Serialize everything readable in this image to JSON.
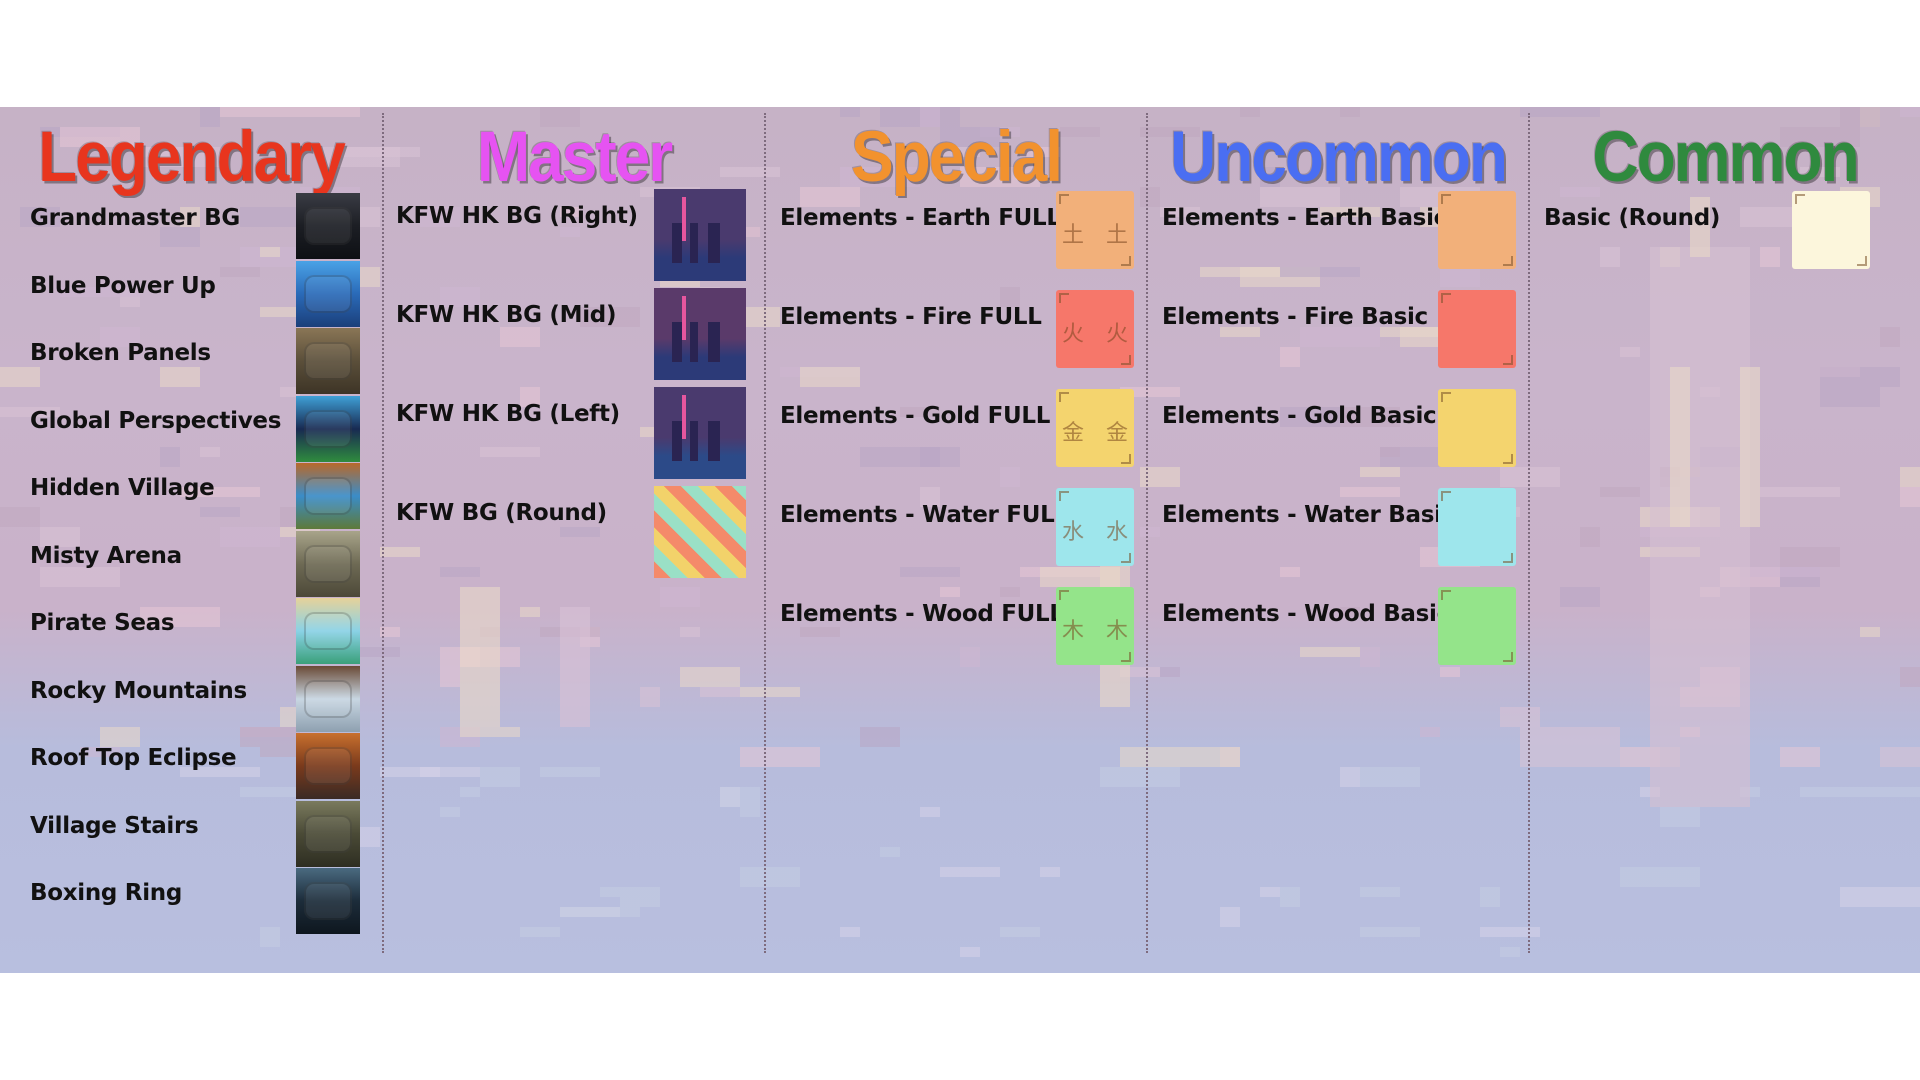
{
  "columns": [
    {
      "key": "legendary",
      "title": "Legendary",
      "title_color": "#e8351e",
      "items": [
        {
          "label": "Grandmaster BG",
          "thumb": "dark-temple",
          "colors": [
            "#1c1e24",
            "#3a3c44",
            "#0e1014"
          ]
        },
        {
          "label": "Blue Power Up",
          "thumb": "blue-energy",
          "colors": [
            "#2a6ab8",
            "#4aa2e6",
            "#1b3f7a"
          ]
        },
        {
          "label": "Broken Panels",
          "thumb": "panels",
          "colors": [
            "#5b4f3a",
            "#8a7656",
            "#3d3426"
          ]
        },
        {
          "label": "Global Perspectives",
          "thumb": "globe-night",
          "colors": [
            "#182a52",
            "#3fa0d6",
            "#2f8c3e"
          ]
        },
        {
          "label": "Hidden Village",
          "thumb": "mountains",
          "colors": [
            "#3a8cc8",
            "#b8692a",
            "#5e7a3a"
          ]
        },
        {
          "label": "Misty Arena",
          "thumb": "mist",
          "colors": [
            "#6e6a54",
            "#a8a48a",
            "#4c4838"
          ]
        },
        {
          "label": "Pirate Seas",
          "thumb": "beach",
          "colors": [
            "#8ad2e6",
            "#e6d29a",
            "#3aa07a"
          ]
        },
        {
          "label": "Rocky Mountains",
          "thumb": "rocks",
          "colors": [
            "#c8d6e2",
            "#6a4a36",
            "#8ea0b0"
          ]
        },
        {
          "label": "Roof Top Eclipse",
          "thumb": "eclipse",
          "colors": [
            "#7a3a1c",
            "#c8702e",
            "#3a2a24"
          ]
        },
        {
          "label": "Village Stairs",
          "thumb": "stairs",
          "colors": [
            "#4a4a36",
            "#7a7a5e",
            "#2e2e22"
          ]
        },
        {
          "label": "Boxing Ring",
          "thumb": "ring",
          "colors": [
            "#1c2c3a",
            "#4a6a80",
            "#0e161e"
          ]
        }
      ]
    },
    {
      "key": "master",
      "title": "Master",
      "title_color": "#e653f2",
      "items": [
        {
          "label": "KFW HK BG (Right)",
          "thumb": "hk-night",
          "colors": [
            "#4a3a6e",
            "#2c3a78",
            "#e6569e"
          ]
        },
        {
          "label": "KFW HK BG (Mid)",
          "thumb": "hk-night",
          "colors": [
            "#5a3a6a",
            "#2c3a78",
            "#e6569e"
          ]
        },
        {
          "label": "KFW HK BG (Left)",
          "thumb": "hk-night",
          "colors": [
            "#4a3a6e",
            "#2c4a88",
            "#e6569e"
          ]
        },
        {
          "label": "KFW BG (Round)",
          "thumb": "checker",
          "colors": [
            "#f48a6a",
            "#9ae0c6",
            "#f2d26a"
          ]
        }
      ]
    },
    {
      "key": "special",
      "title": "Special",
      "title_color": "#f2922e",
      "items": [
        {
          "label": "Elements - Earth FULL",
          "glyph": "土",
          "color": "#f2b07a"
        },
        {
          "label": "Elements - Fire FULL",
          "glyph": "火",
          "color": "#f6776a"
        },
        {
          "label": "Elements - Gold FULL",
          "glyph": "金",
          "color": "#f4d46e"
        },
        {
          "label": "Elements - Water FULL",
          "glyph": "水",
          "color": "#9ee6ec"
        },
        {
          "label": "Elements - Wood FULL",
          "glyph": "木",
          "color": "#94e48a"
        }
      ]
    },
    {
      "key": "uncommon",
      "title": "Uncommon",
      "title_color": "#4a6ef2",
      "items": [
        {
          "label": "Elements - Earth Basic",
          "color": "#f2b07a"
        },
        {
          "label": "Elements - Fire Basic",
          "color": "#f6776a"
        },
        {
          "label": "Elements - Gold Basic",
          "color": "#f4d46e"
        },
        {
          "label": "Elements - Water Basic",
          "color": "#9ee6ec"
        },
        {
          "label": "Elements - Wood Basic",
          "color": "#94e48a"
        }
      ]
    },
    {
      "key": "common",
      "title": "Common",
      "title_color": "#2f8a3e",
      "items": [
        {
          "label": "Basic (Round)",
          "color": "#fcf6dc"
        }
      ]
    }
  ]
}
